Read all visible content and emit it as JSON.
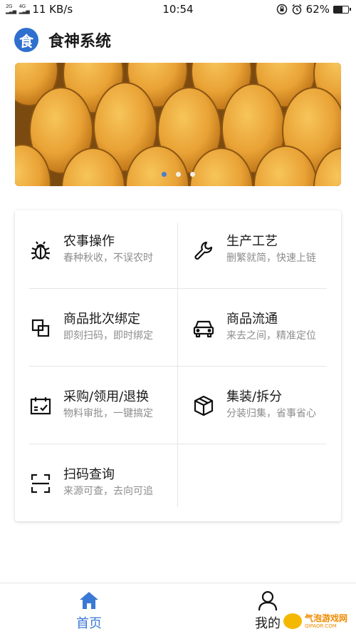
{
  "status_bar": {
    "network_type": "2G",
    "network_type2": "4G",
    "speed": "11 KB/s",
    "time": "10:54",
    "battery": "62%",
    "battery_level": 0.62
  },
  "header": {
    "logo_char": "食",
    "title": "食神系统"
  },
  "banner": {
    "slide_count": 3,
    "active_index": 0
  },
  "menu": [
    {
      "title": "农事操作",
      "subtitle": "春种秋收，不误农时",
      "icon": "bug-icon"
    },
    {
      "title": "生产工艺",
      "subtitle": "删繁就简，快速上链",
      "icon": "wrench-icon"
    },
    {
      "title": "商品批次绑定",
      "subtitle": "即刻扫码，即时绑定",
      "icon": "overlap-squares-icon"
    },
    {
      "title": "商品流通",
      "subtitle": "来去之间，精准定位",
      "icon": "car-icon"
    },
    {
      "title": "采购/领用/退换",
      "subtitle": "物料审批，一键搞定",
      "icon": "calendar-check-icon"
    },
    {
      "title": "集装/拆分",
      "subtitle": "分装归集，省事省心",
      "icon": "box-icon"
    },
    {
      "title": "扫码查询",
      "subtitle": "来源可查，去向可追",
      "icon": "scan-icon"
    }
  ],
  "tabbar": {
    "home_label": "首页",
    "mine_label": "我的"
  },
  "watermark": {
    "text": "气泡游戏网",
    "sub": "QIPAOR.COM"
  },
  "colors": {
    "accent": "#3b79d6",
    "logo_bg": "#2f6fce",
    "subtitle": "#8d8d8d"
  }
}
